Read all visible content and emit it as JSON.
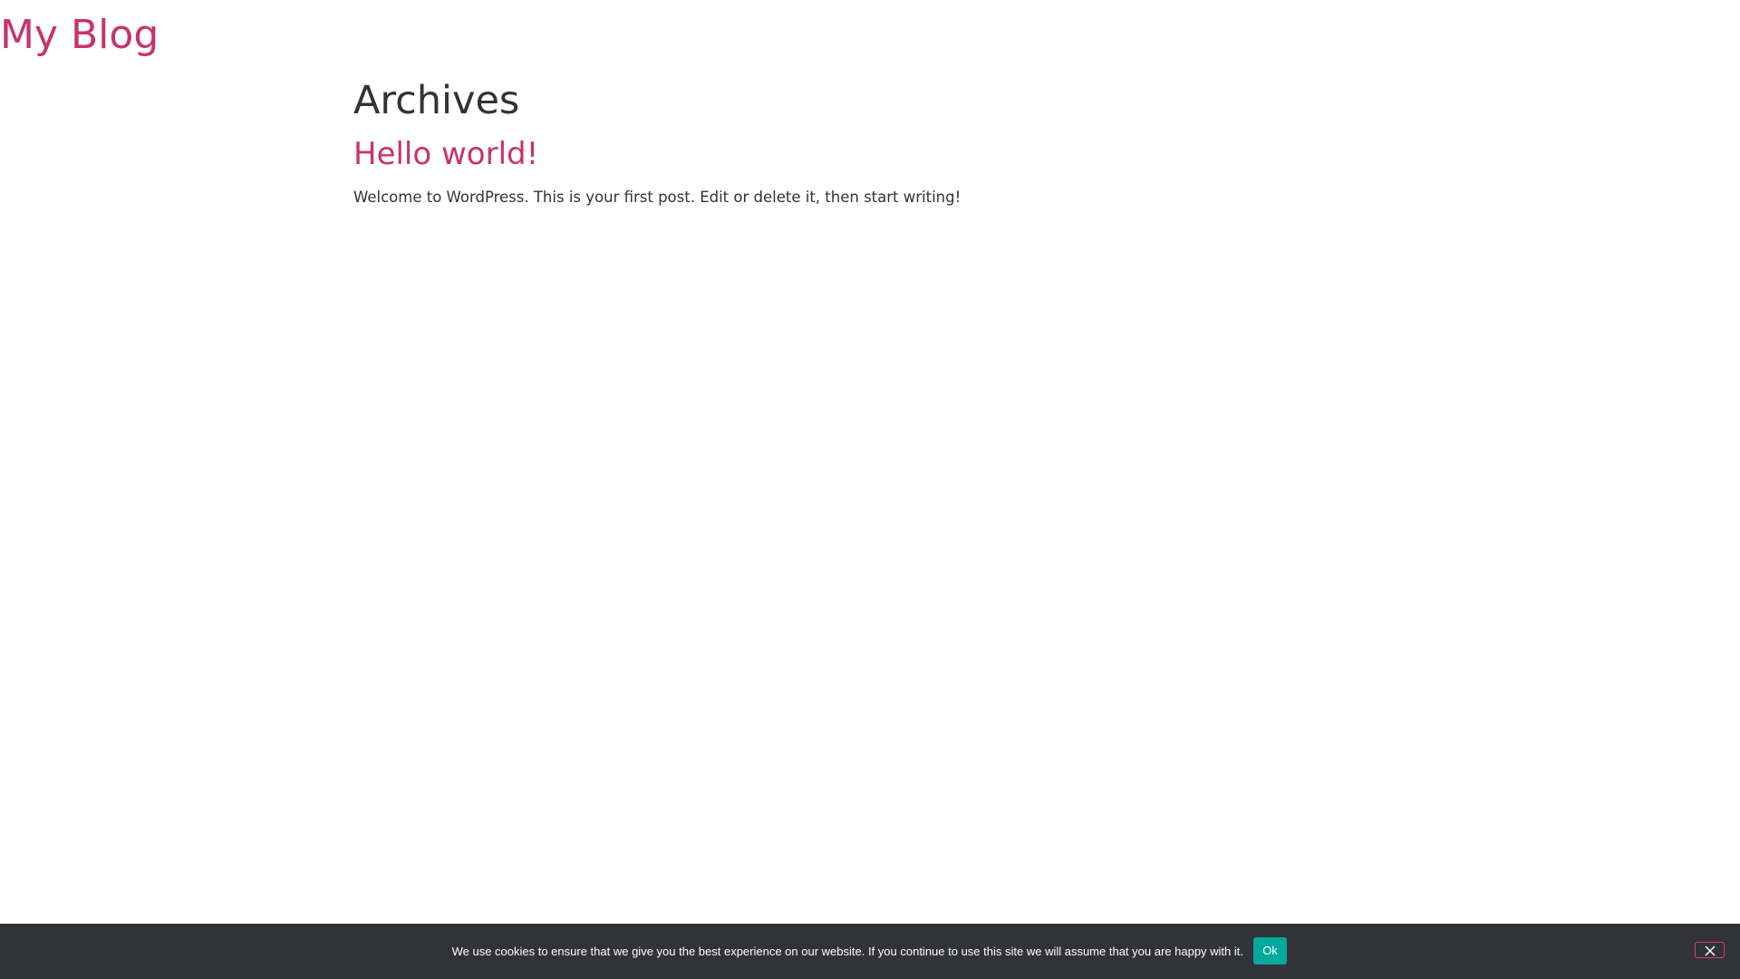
{
  "site": {
    "title": "My Blog"
  },
  "archive": {
    "heading": "Archives",
    "posts": [
      {
        "title": "Hello world!",
        "excerpt": "Welcome to WordPress. This is your first post. Edit or delete it, then start writing!"
      }
    ]
  },
  "cookie_notice": {
    "message": "We use cookies to ensure that we give you the best experience on our website. If you continue to use this site we will assume that you are happy with it.",
    "accept_label": "Ok",
    "close_icon": "close-icon"
  },
  "colors": {
    "accent": "#c8336a",
    "text": "#333333",
    "cookie_bar_bg": "#32323a",
    "ok_button_bg": "#00a99d"
  }
}
